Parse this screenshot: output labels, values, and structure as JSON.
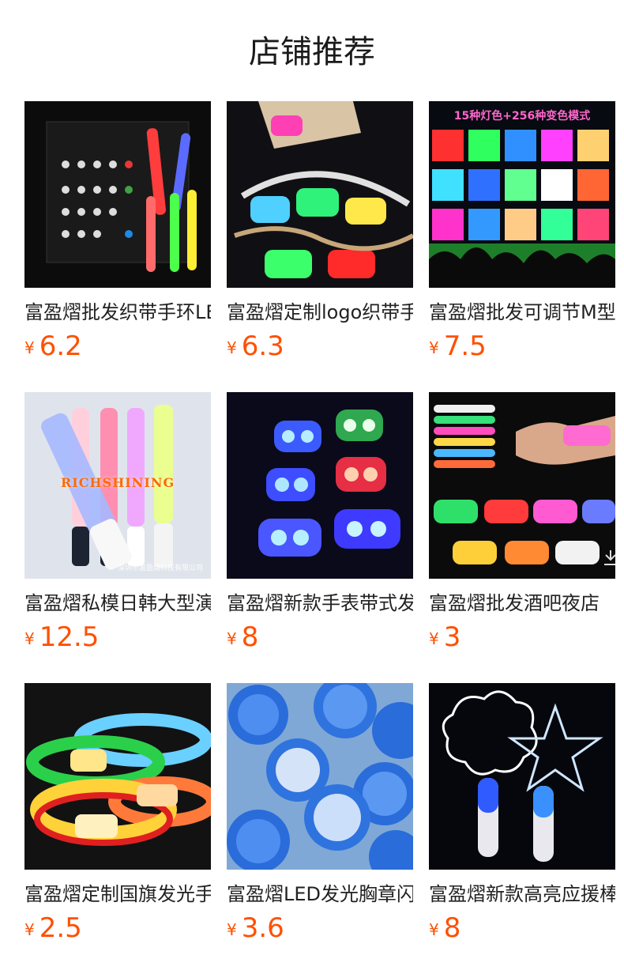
{
  "header": {
    "title": "店铺推荐"
  },
  "currency": "¥",
  "products": [
    {
      "name": "富盈熠批发织带手环LED",
      "price": "6.2"
    },
    {
      "name": "富盈熠定制logo织带手环",
      "price": "6.3"
    },
    {
      "name": "富盈熠批发可调节M型",
      "price": "7.5",
      "banner": "15种灯色+256种变色模式"
    },
    {
      "name": "富盈熠私模日韩大型演唱会",
      "price": "12.5",
      "overlay": "RICHSHINING",
      "watermark": "深圳市富盈熠科技有限公司"
    },
    {
      "name": "富盈熠新款手表带式发光",
      "price": "8"
    },
    {
      "name": "富盈熠批发酒吧夜店",
      "price": "3"
    },
    {
      "name": "富盈熠定制国旗发光手环",
      "price": "2.5"
    },
    {
      "name": "富盈熠LED发光胸章闪",
      "price": "3.6"
    },
    {
      "name": "富盈熠新款高亮应援棒",
      "price": "8"
    }
  ],
  "colors": {
    "price": "#ff5000",
    "title": "#1a1a1a"
  }
}
